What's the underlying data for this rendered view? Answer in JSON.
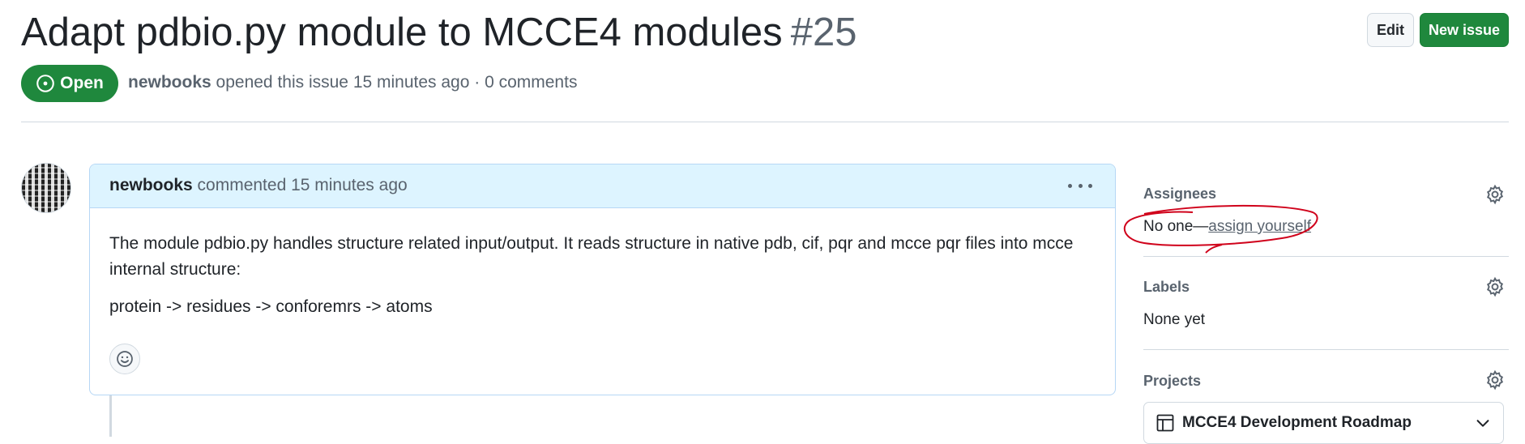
{
  "issue": {
    "title": "Adapt pdbio.py module to MCCE4 modules",
    "number": "#25",
    "state": "Open",
    "author": "newbooks",
    "meta_text": "opened this issue 15 minutes ago · 0 comments"
  },
  "actions": {
    "edit_label": "Edit",
    "new_issue_label": "New issue"
  },
  "comment": {
    "author": "newbooks",
    "header_text": "commented 15 minutes ago",
    "paragraphs": [
      "The module pdbio.py handles structure related input/output. It reads structure in native pdb, cif, pqr and mcce pqr files into mcce internal structure:",
      "protein -> residues -> conforemrs -> atoms"
    ]
  },
  "sidebar": {
    "assignees": {
      "title": "Assignees",
      "value": "No one—",
      "link": "assign yourself"
    },
    "labels": {
      "title": "Labels",
      "value": "None yet"
    },
    "projects": {
      "title": "Projects",
      "project_name": "MCCE4 Development Roadmap"
    }
  },
  "colors": {
    "open_green": "#1f883d",
    "comment_header_bg": "#ddf4ff",
    "annotation_red": "#d0021b"
  },
  "icons": [
    "issue-opened-icon",
    "kebab-horizontal-icon",
    "smiley-icon",
    "gear-icon",
    "table-icon",
    "chevron-down-icon"
  ]
}
